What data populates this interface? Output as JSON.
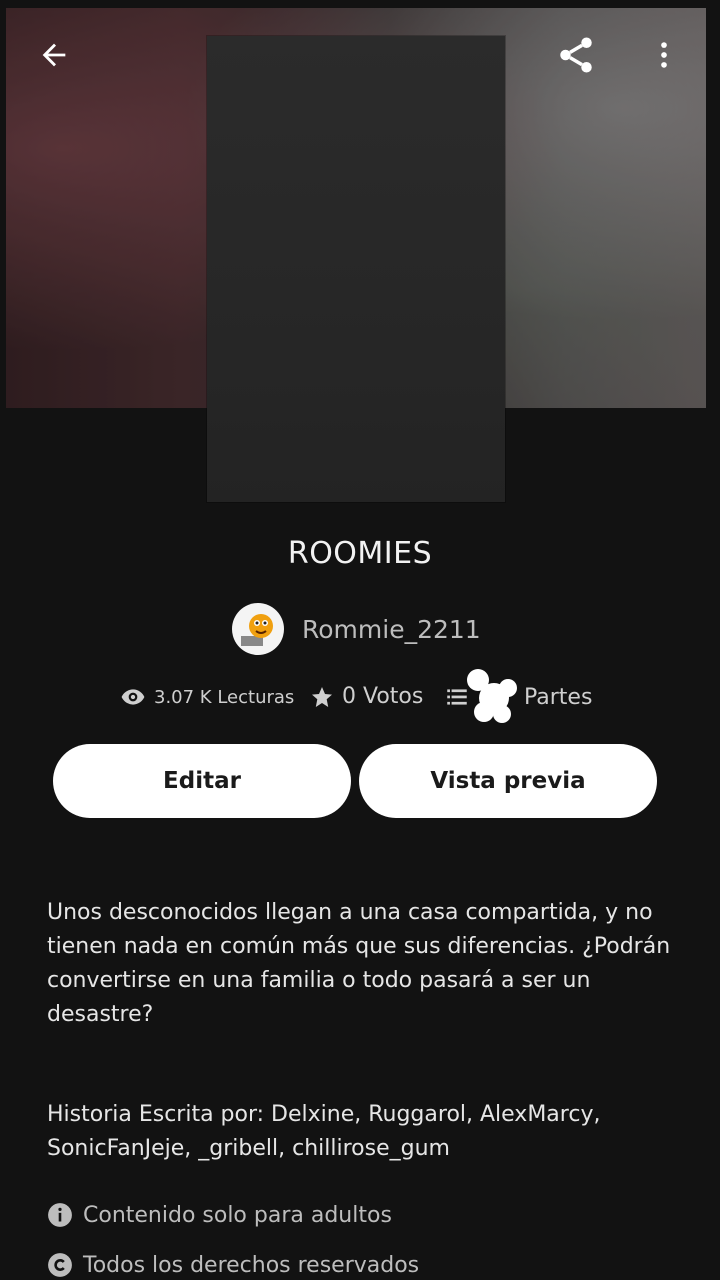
{
  "header": {
    "back_icon": "arrow-left-icon",
    "share_icon": "share-icon",
    "more_icon": "more-vert-icon"
  },
  "story": {
    "title": "ROOMIES",
    "author": "Rommie_2211",
    "stats": {
      "reads": "3.07 K Lecturas",
      "votes": "0 Votos",
      "parts": "Partes"
    }
  },
  "actions": {
    "edit_label": "Editar",
    "preview_label": "Vista previa"
  },
  "description": "Unos desconocidos llegan a una casa compartida, y no tienen nada en común más que sus diferencias. ¿Podrán convertirse en una familia o todo pasará a ser un desastre?",
  "credits": "Historia Escrita por: Delxine, Ruggarol, AlexMarcy, SonicFanJeje, _gribell, chillirose_gum",
  "info": {
    "adult": "Contenido solo para adultos",
    "rights": "Todos los derechos reservados"
  },
  "colors": {
    "background": "#121212",
    "button": "#ffffff",
    "text": "#ececec"
  }
}
